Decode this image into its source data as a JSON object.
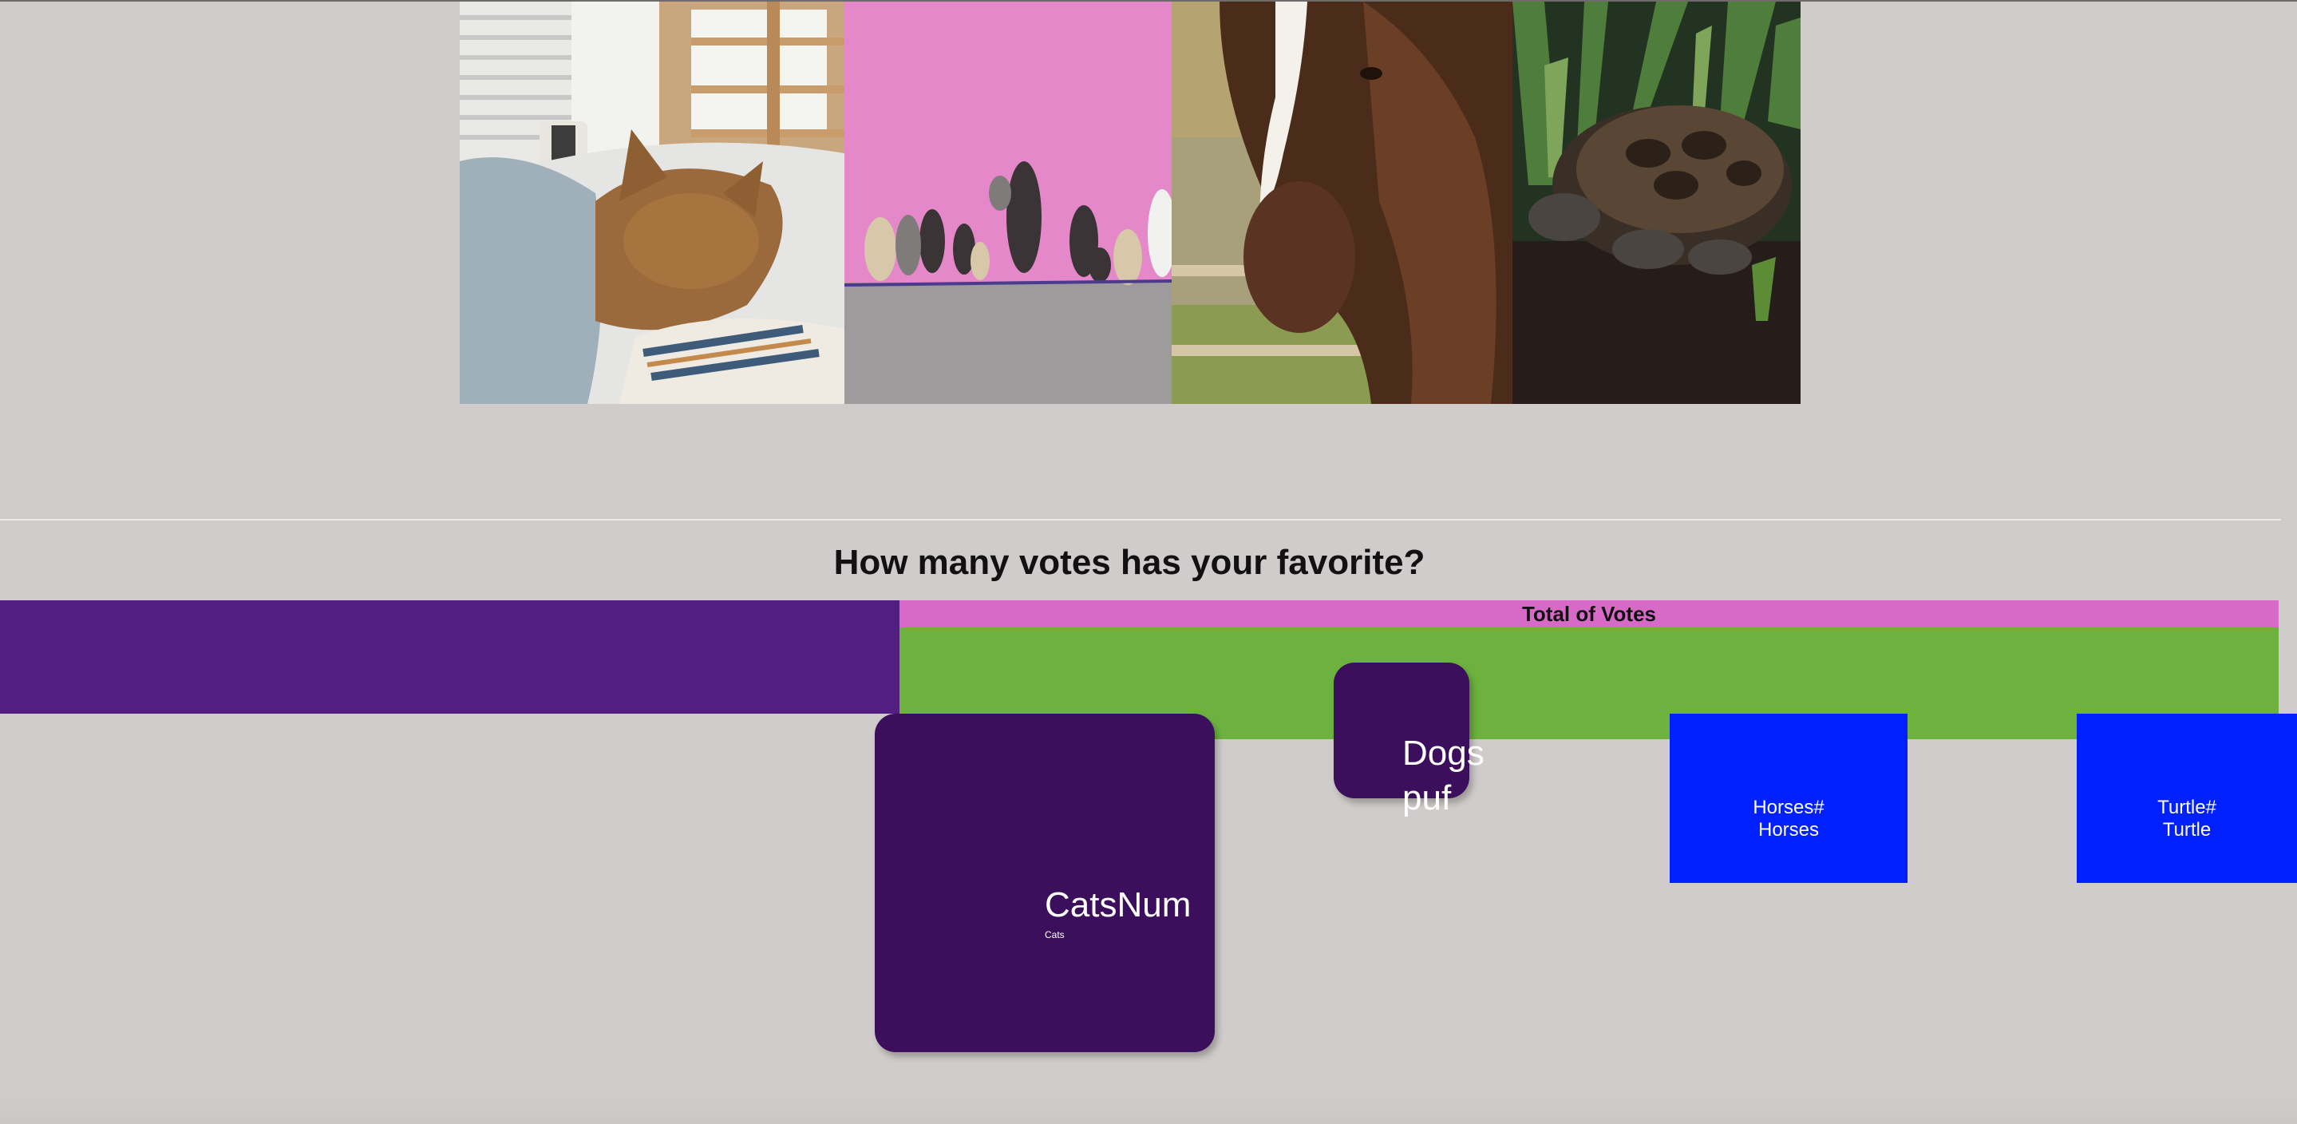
{
  "gallery": {
    "photos": [
      {
        "subject": "cat",
        "icon": "cat-photo"
      },
      {
        "subject": "dogs",
        "icon": "dogs-photo"
      },
      {
        "subject": "horse",
        "icon": "horse-photo"
      },
      {
        "subject": "turtle",
        "icon": "turtle-photo"
      }
    ]
  },
  "votes": {
    "heading": "How many votes has your favorite?",
    "total_label": "Total of Votes",
    "cats": {
      "value": "CatsNum",
      "label": "Cats"
    },
    "dogs": {
      "line1": "Dogs",
      "line2": "puf"
    },
    "horses": {
      "line1": "Horses#",
      "line2": "Horses"
    },
    "turtle": {
      "line1": "Turtle#",
      "line2": "Turtle"
    }
  },
  "colors": {
    "background": "#d0cccb",
    "purple_bar": "#521e7f",
    "card_purple": "#3b0f5b",
    "pink_header": "#d86ac7",
    "green_band": "#6db23f",
    "card_blue": "#0020ff"
  }
}
